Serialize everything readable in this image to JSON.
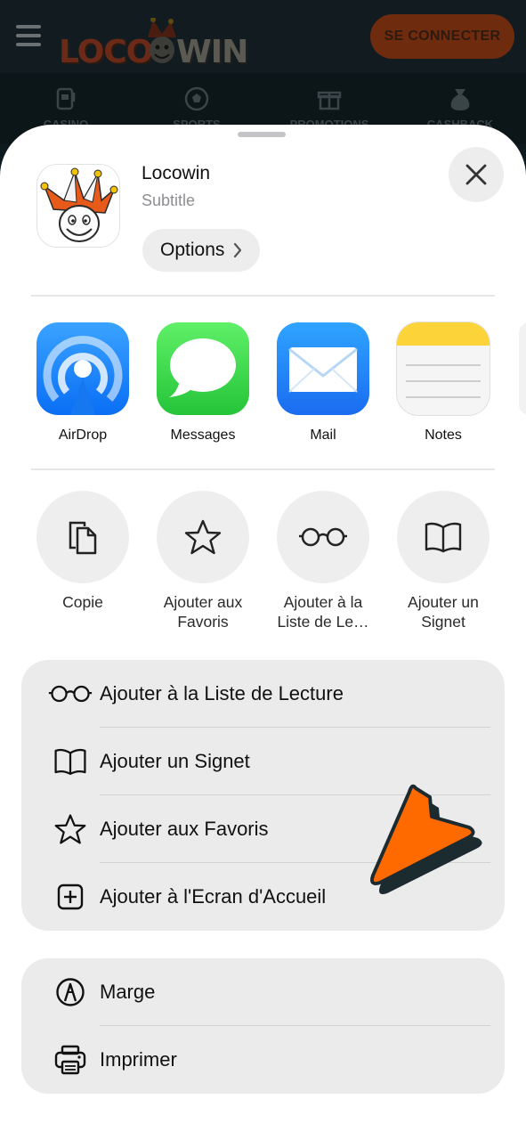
{
  "background": {
    "logo_left": "LOCO",
    "logo_right": "WIN",
    "connect_label": "SE CONNECTER",
    "nav": [
      "CASINO",
      "SPORTS",
      "PROMOTIONS",
      "CASHBACK"
    ]
  },
  "sheet": {
    "app_title": "Locowin",
    "app_subtitle": "Subtitle",
    "options_label": "Options",
    "share_apps": [
      {
        "label": "AirDrop",
        "icon": "airdrop-icon"
      },
      {
        "label": "Messages",
        "icon": "messages-icon"
      },
      {
        "label": "Mail",
        "icon": "mail-icon"
      },
      {
        "label": "Notes",
        "icon": "notes-icon"
      }
    ],
    "actions": [
      {
        "label": "Copie",
        "icon": "copy-icon"
      },
      {
        "label": "Ajouter aux Favoris",
        "icon": "star-icon"
      },
      {
        "label": "Ajouter à la Liste de Le…",
        "icon": "glasses-icon"
      },
      {
        "label": "Ajouter un Signet",
        "icon": "book-icon"
      }
    ],
    "list_group_1": [
      {
        "label": "Ajouter à la Liste de Lecture",
        "icon": "glasses-icon"
      },
      {
        "label": "Ajouter un Signet",
        "icon": "book-icon"
      },
      {
        "label": "Ajouter aux Favoris",
        "icon": "star-icon"
      },
      {
        "label": "Ajouter à l'Ecran d'Accueil",
        "icon": "plus-square-icon"
      }
    ],
    "list_group_2": [
      {
        "label": "Marge",
        "icon": "markup-icon"
      },
      {
        "label": "Imprimer",
        "icon": "printer-icon"
      }
    ]
  },
  "colors": {
    "accent_orange": "#ff6a00",
    "sheet_background": "#ffffff",
    "group_background": "#ebebec"
  }
}
